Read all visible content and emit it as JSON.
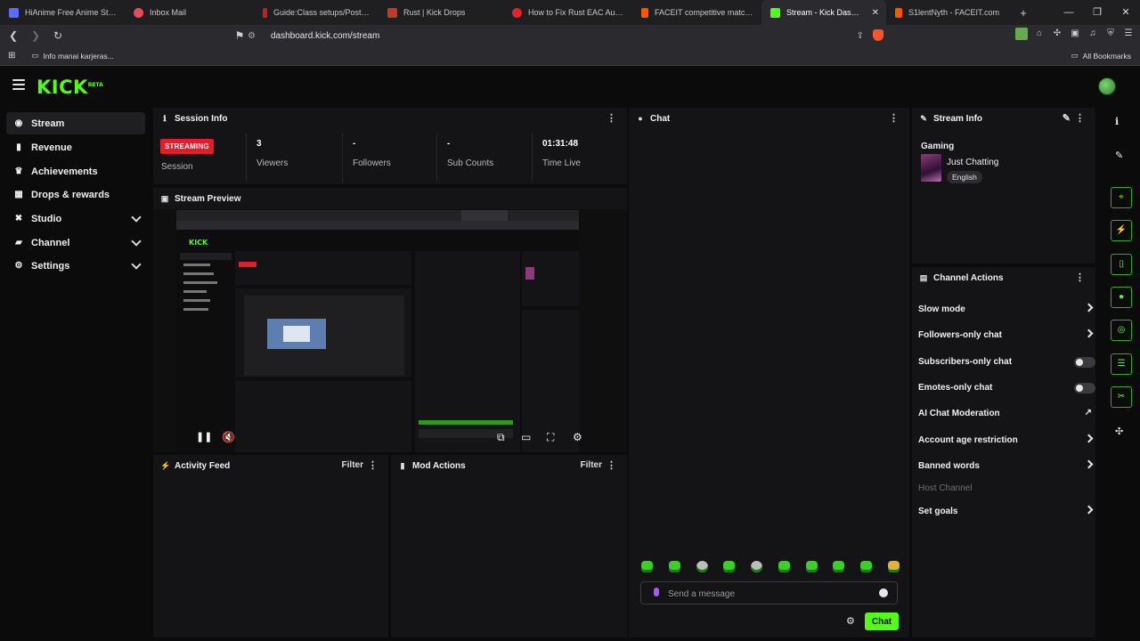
{
  "browser": {
    "tabs": [
      {
        "title": "HiAnime Free Anime Streaming",
        "color": "#5b6cff"
      },
      {
        "title": "Inbox Mail",
        "color": "#e64b5b"
      },
      {
        "title": "Guide:Class setups/Post-Moon",
        "color": "#c21f2c"
      },
      {
        "title": "Rust | Kick Drops",
        "color": "#c0392b"
      },
      {
        "title": "How to Fix Rust EAC Auth Disc",
        "color": "#e5202a"
      },
      {
        "title": "FACEIT competitive match - FA",
        "color": "#ff5500"
      },
      {
        "title": "Stream - Kick Dashboard",
        "color": "#53fc18"
      },
      {
        "title": "S1lentNyth - FACEIT.com",
        "color": "#ff5500"
      }
    ],
    "url": "dashboard.kick.com/stream",
    "bookmark": "Info manai karjeras...",
    "all_bookmarks": "All Bookmarks"
  },
  "brand": {
    "logo": "KICK",
    "beta": "BETA",
    "accent": "#53fc18"
  },
  "sidebar": {
    "items": [
      {
        "label": "Stream",
        "icon": "stream-icon"
      },
      {
        "label": "Revenue",
        "icon": "revenue-icon"
      },
      {
        "label": "Achievements",
        "icon": "trophy-icon"
      },
      {
        "label": "Drops & rewards",
        "icon": "drops-icon"
      },
      {
        "label": "Studio",
        "icon": "studio-icon"
      },
      {
        "label": "Channel",
        "icon": "channel-icon"
      },
      {
        "label": "Settings",
        "icon": "gear-icon"
      }
    ]
  },
  "session": {
    "title": "Session Info",
    "status": "STREAMING",
    "status_label": "Session",
    "stats": [
      {
        "value": "3",
        "label": "Viewers"
      },
      {
        "value": "-",
        "label": "Followers"
      },
      {
        "value": "-",
        "label": "Sub Counts"
      },
      {
        "value": "01:31:48",
        "label": "Time Live"
      }
    ]
  },
  "preview": {
    "title": "Stream Preview"
  },
  "activity": {
    "title": "Activity Feed",
    "filter": "Filter"
  },
  "mod": {
    "title": "Mod Actions",
    "filter": "Filter"
  },
  "chat": {
    "title": "Chat",
    "placeholder": "Send a message",
    "send": "Chat"
  },
  "stream_info": {
    "title": "Stream Info",
    "category_group": "Gaming",
    "category": "Just Chatting",
    "tag": "English"
  },
  "channel_actions": {
    "title": "Channel Actions",
    "items": [
      {
        "label": "Slow mode",
        "control": "arrow"
      },
      {
        "label": "Followers-only chat",
        "control": "arrow"
      },
      {
        "label": "Subscribers-only chat",
        "control": "toggle",
        "on": false
      },
      {
        "label": "Emotes-only chat",
        "control": "toggle",
        "on": false
      },
      {
        "label": "AI Chat Moderation",
        "control": "external"
      },
      {
        "label": "Account age restriction",
        "control": "arrow"
      },
      {
        "label": "Banned words",
        "control": "arrow"
      },
      {
        "label": "Host Channel",
        "control": "none",
        "disabled": true
      },
      {
        "label": "Set goals",
        "control": "arrow"
      }
    ]
  }
}
